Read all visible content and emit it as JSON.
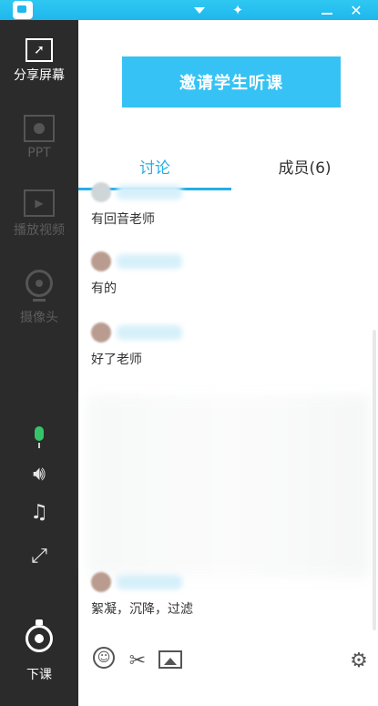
{
  "sidebar": {
    "items": [
      {
        "label": "分享屏幕",
        "icon": "share-screen-icon",
        "state": "active"
      },
      {
        "label": "PPT",
        "icon": "ppt-icon",
        "state": "disabled"
      },
      {
        "label": "播放视频",
        "icon": "play-video-icon",
        "state": "disabled"
      },
      {
        "label": "摄像头",
        "icon": "camera-icon",
        "state": "disabled"
      }
    ],
    "controls": [
      "microphone-icon",
      "speaker-icon",
      "music-icon",
      "fullscreen-icon"
    ],
    "end_class_label": "下课"
  },
  "main": {
    "invite_button_label": "邀请学生听课",
    "tabs": [
      {
        "label": "讨论",
        "active": true
      },
      {
        "label": "成员(6)",
        "active": false
      }
    ],
    "messages": [
      {
        "text": "有回音老师"
      },
      {
        "text": "有的"
      },
      {
        "text": "好了老师"
      },
      {
        "text": "絮凝，沉降，过滤"
      }
    ]
  },
  "colors": {
    "accent": "#24aee7",
    "sidebar_bg": "#2b2b2b",
    "button_bg": "#36c2f4",
    "mic_active": "#36c46b"
  }
}
